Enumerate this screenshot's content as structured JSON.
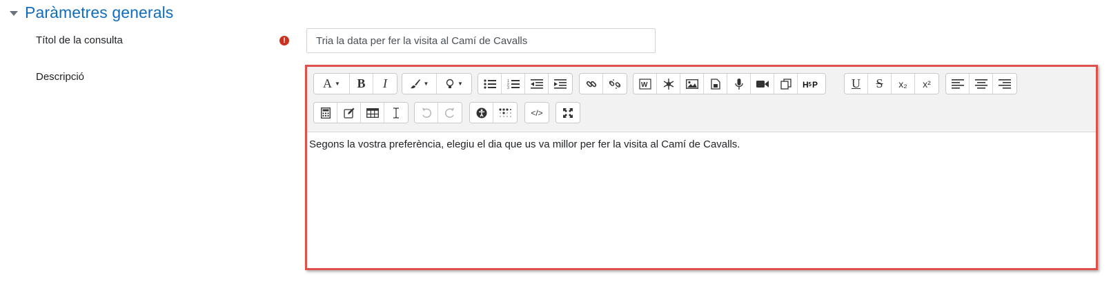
{
  "section": {
    "title": "Paràmetres generals"
  },
  "fields": {
    "title_label": "Títol de la consulta",
    "title_value": "Tria la data per fer la visita al Camí de Cavalls",
    "required_symbol": "!",
    "description_label": "Descripció"
  },
  "editor": {
    "content": "Segons la vostra preferència, elegiu el dia que us va millor per fer la visita al Camí de Cavalls.",
    "buttons": {
      "bold": "B",
      "italic": "I",
      "underline": "U",
      "strikethrough": "S",
      "subscript": "x₂",
      "superscript": "x²",
      "code": "</>"
    }
  },
  "colors": {
    "accent": "#0f6cbf",
    "required": "#ca3120",
    "highlight_border": "#e0504a"
  },
  "icons": [
    "font-size-icon",
    "paint-brush-icon",
    "lightbulb-icon",
    "unordered-list-icon",
    "ordered-list-icon",
    "outdent-icon",
    "indent-icon",
    "link-icon",
    "unlink-icon",
    "word-import-icon",
    "snowflake-icon",
    "image-icon",
    "media-icon",
    "microphone-icon",
    "video-icon",
    "copy-icon",
    "h5p-icon",
    "align-left-icon",
    "align-center-icon",
    "align-right-icon",
    "calculator-icon",
    "edit-icon",
    "table-icon",
    "cursor-icon",
    "undo-icon",
    "redo-icon",
    "accessibility-icon",
    "braille-icon",
    "fullscreen-icon"
  ]
}
